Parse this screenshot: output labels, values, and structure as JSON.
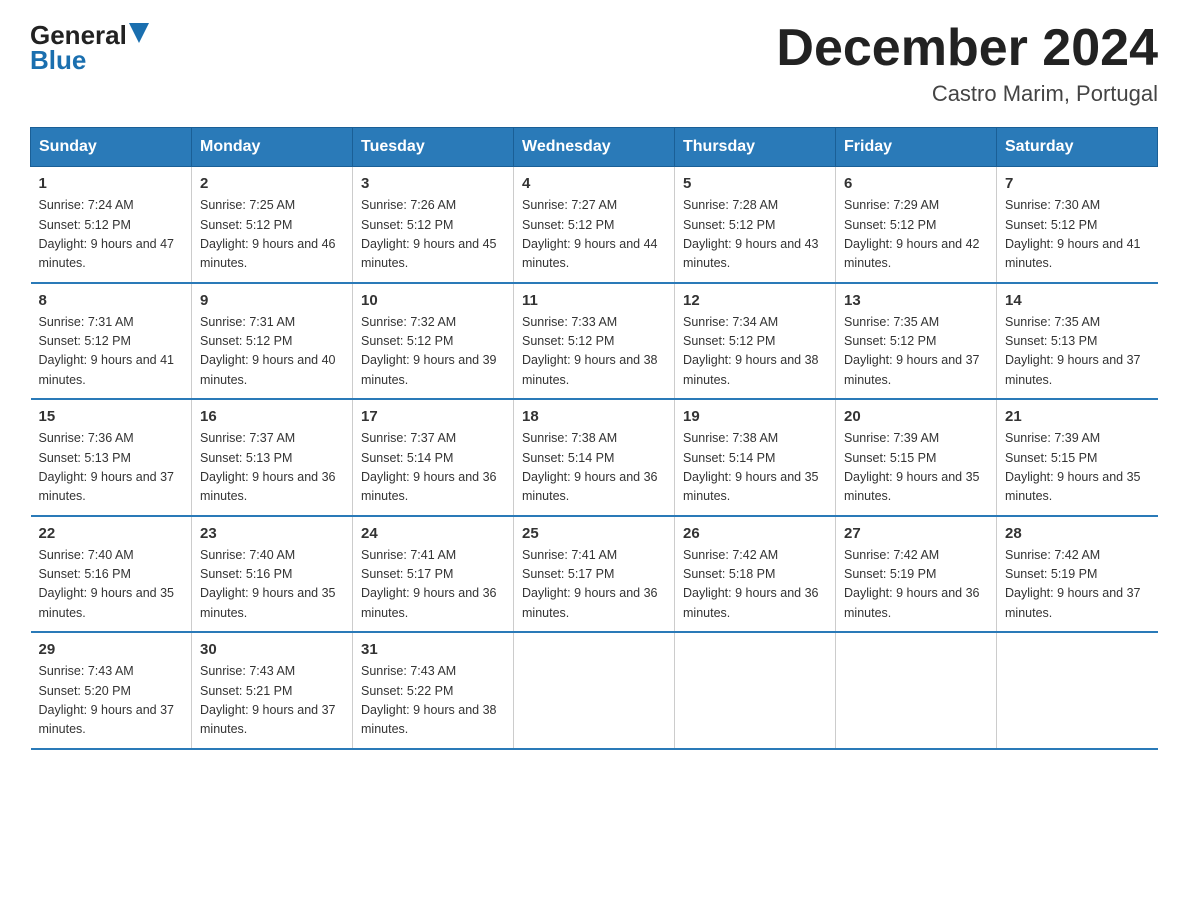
{
  "header": {
    "logo_general": "General",
    "logo_blue": "Blue",
    "month_title": "December 2024",
    "location": "Castro Marim, Portugal"
  },
  "columns": [
    "Sunday",
    "Monday",
    "Tuesday",
    "Wednesday",
    "Thursday",
    "Friday",
    "Saturday"
  ],
  "weeks": [
    [
      {
        "day": "1",
        "sunrise": "Sunrise: 7:24 AM",
        "sunset": "Sunset: 5:12 PM",
        "daylight": "Daylight: 9 hours and 47 minutes."
      },
      {
        "day": "2",
        "sunrise": "Sunrise: 7:25 AM",
        "sunset": "Sunset: 5:12 PM",
        "daylight": "Daylight: 9 hours and 46 minutes."
      },
      {
        "day": "3",
        "sunrise": "Sunrise: 7:26 AM",
        "sunset": "Sunset: 5:12 PM",
        "daylight": "Daylight: 9 hours and 45 minutes."
      },
      {
        "day": "4",
        "sunrise": "Sunrise: 7:27 AM",
        "sunset": "Sunset: 5:12 PM",
        "daylight": "Daylight: 9 hours and 44 minutes."
      },
      {
        "day": "5",
        "sunrise": "Sunrise: 7:28 AM",
        "sunset": "Sunset: 5:12 PM",
        "daylight": "Daylight: 9 hours and 43 minutes."
      },
      {
        "day": "6",
        "sunrise": "Sunrise: 7:29 AM",
        "sunset": "Sunset: 5:12 PM",
        "daylight": "Daylight: 9 hours and 42 minutes."
      },
      {
        "day": "7",
        "sunrise": "Sunrise: 7:30 AM",
        "sunset": "Sunset: 5:12 PM",
        "daylight": "Daylight: 9 hours and 41 minutes."
      }
    ],
    [
      {
        "day": "8",
        "sunrise": "Sunrise: 7:31 AM",
        "sunset": "Sunset: 5:12 PM",
        "daylight": "Daylight: 9 hours and 41 minutes."
      },
      {
        "day": "9",
        "sunrise": "Sunrise: 7:31 AM",
        "sunset": "Sunset: 5:12 PM",
        "daylight": "Daylight: 9 hours and 40 minutes."
      },
      {
        "day": "10",
        "sunrise": "Sunrise: 7:32 AM",
        "sunset": "Sunset: 5:12 PM",
        "daylight": "Daylight: 9 hours and 39 minutes."
      },
      {
        "day": "11",
        "sunrise": "Sunrise: 7:33 AM",
        "sunset": "Sunset: 5:12 PM",
        "daylight": "Daylight: 9 hours and 38 minutes."
      },
      {
        "day": "12",
        "sunrise": "Sunrise: 7:34 AM",
        "sunset": "Sunset: 5:12 PM",
        "daylight": "Daylight: 9 hours and 38 minutes."
      },
      {
        "day": "13",
        "sunrise": "Sunrise: 7:35 AM",
        "sunset": "Sunset: 5:12 PM",
        "daylight": "Daylight: 9 hours and 37 minutes."
      },
      {
        "day": "14",
        "sunrise": "Sunrise: 7:35 AM",
        "sunset": "Sunset: 5:13 PM",
        "daylight": "Daylight: 9 hours and 37 minutes."
      }
    ],
    [
      {
        "day": "15",
        "sunrise": "Sunrise: 7:36 AM",
        "sunset": "Sunset: 5:13 PM",
        "daylight": "Daylight: 9 hours and 37 minutes."
      },
      {
        "day": "16",
        "sunrise": "Sunrise: 7:37 AM",
        "sunset": "Sunset: 5:13 PM",
        "daylight": "Daylight: 9 hours and 36 minutes."
      },
      {
        "day": "17",
        "sunrise": "Sunrise: 7:37 AM",
        "sunset": "Sunset: 5:14 PM",
        "daylight": "Daylight: 9 hours and 36 minutes."
      },
      {
        "day": "18",
        "sunrise": "Sunrise: 7:38 AM",
        "sunset": "Sunset: 5:14 PM",
        "daylight": "Daylight: 9 hours and 36 minutes."
      },
      {
        "day": "19",
        "sunrise": "Sunrise: 7:38 AM",
        "sunset": "Sunset: 5:14 PM",
        "daylight": "Daylight: 9 hours and 35 minutes."
      },
      {
        "day": "20",
        "sunrise": "Sunrise: 7:39 AM",
        "sunset": "Sunset: 5:15 PM",
        "daylight": "Daylight: 9 hours and 35 minutes."
      },
      {
        "day": "21",
        "sunrise": "Sunrise: 7:39 AM",
        "sunset": "Sunset: 5:15 PM",
        "daylight": "Daylight: 9 hours and 35 minutes."
      }
    ],
    [
      {
        "day": "22",
        "sunrise": "Sunrise: 7:40 AM",
        "sunset": "Sunset: 5:16 PM",
        "daylight": "Daylight: 9 hours and 35 minutes."
      },
      {
        "day": "23",
        "sunrise": "Sunrise: 7:40 AM",
        "sunset": "Sunset: 5:16 PM",
        "daylight": "Daylight: 9 hours and 35 minutes."
      },
      {
        "day": "24",
        "sunrise": "Sunrise: 7:41 AM",
        "sunset": "Sunset: 5:17 PM",
        "daylight": "Daylight: 9 hours and 36 minutes."
      },
      {
        "day": "25",
        "sunrise": "Sunrise: 7:41 AM",
        "sunset": "Sunset: 5:17 PM",
        "daylight": "Daylight: 9 hours and 36 minutes."
      },
      {
        "day": "26",
        "sunrise": "Sunrise: 7:42 AM",
        "sunset": "Sunset: 5:18 PM",
        "daylight": "Daylight: 9 hours and 36 minutes."
      },
      {
        "day": "27",
        "sunrise": "Sunrise: 7:42 AM",
        "sunset": "Sunset: 5:19 PM",
        "daylight": "Daylight: 9 hours and 36 minutes."
      },
      {
        "day": "28",
        "sunrise": "Sunrise: 7:42 AM",
        "sunset": "Sunset: 5:19 PM",
        "daylight": "Daylight: 9 hours and 37 minutes."
      }
    ],
    [
      {
        "day": "29",
        "sunrise": "Sunrise: 7:43 AM",
        "sunset": "Sunset: 5:20 PM",
        "daylight": "Daylight: 9 hours and 37 minutes."
      },
      {
        "day": "30",
        "sunrise": "Sunrise: 7:43 AM",
        "sunset": "Sunset: 5:21 PM",
        "daylight": "Daylight: 9 hours and 37 minutes."
      },
      {
        "day": "31",
        "sunrise": "Sunrise: 7:43 AM",
        "sunset": "Sunset: 5:22 PM",
        "daylight": "Daylight: 9 hours and 38 minutes."
      },
      null,
      null,
      null,
      null
    ]
  ]
}
